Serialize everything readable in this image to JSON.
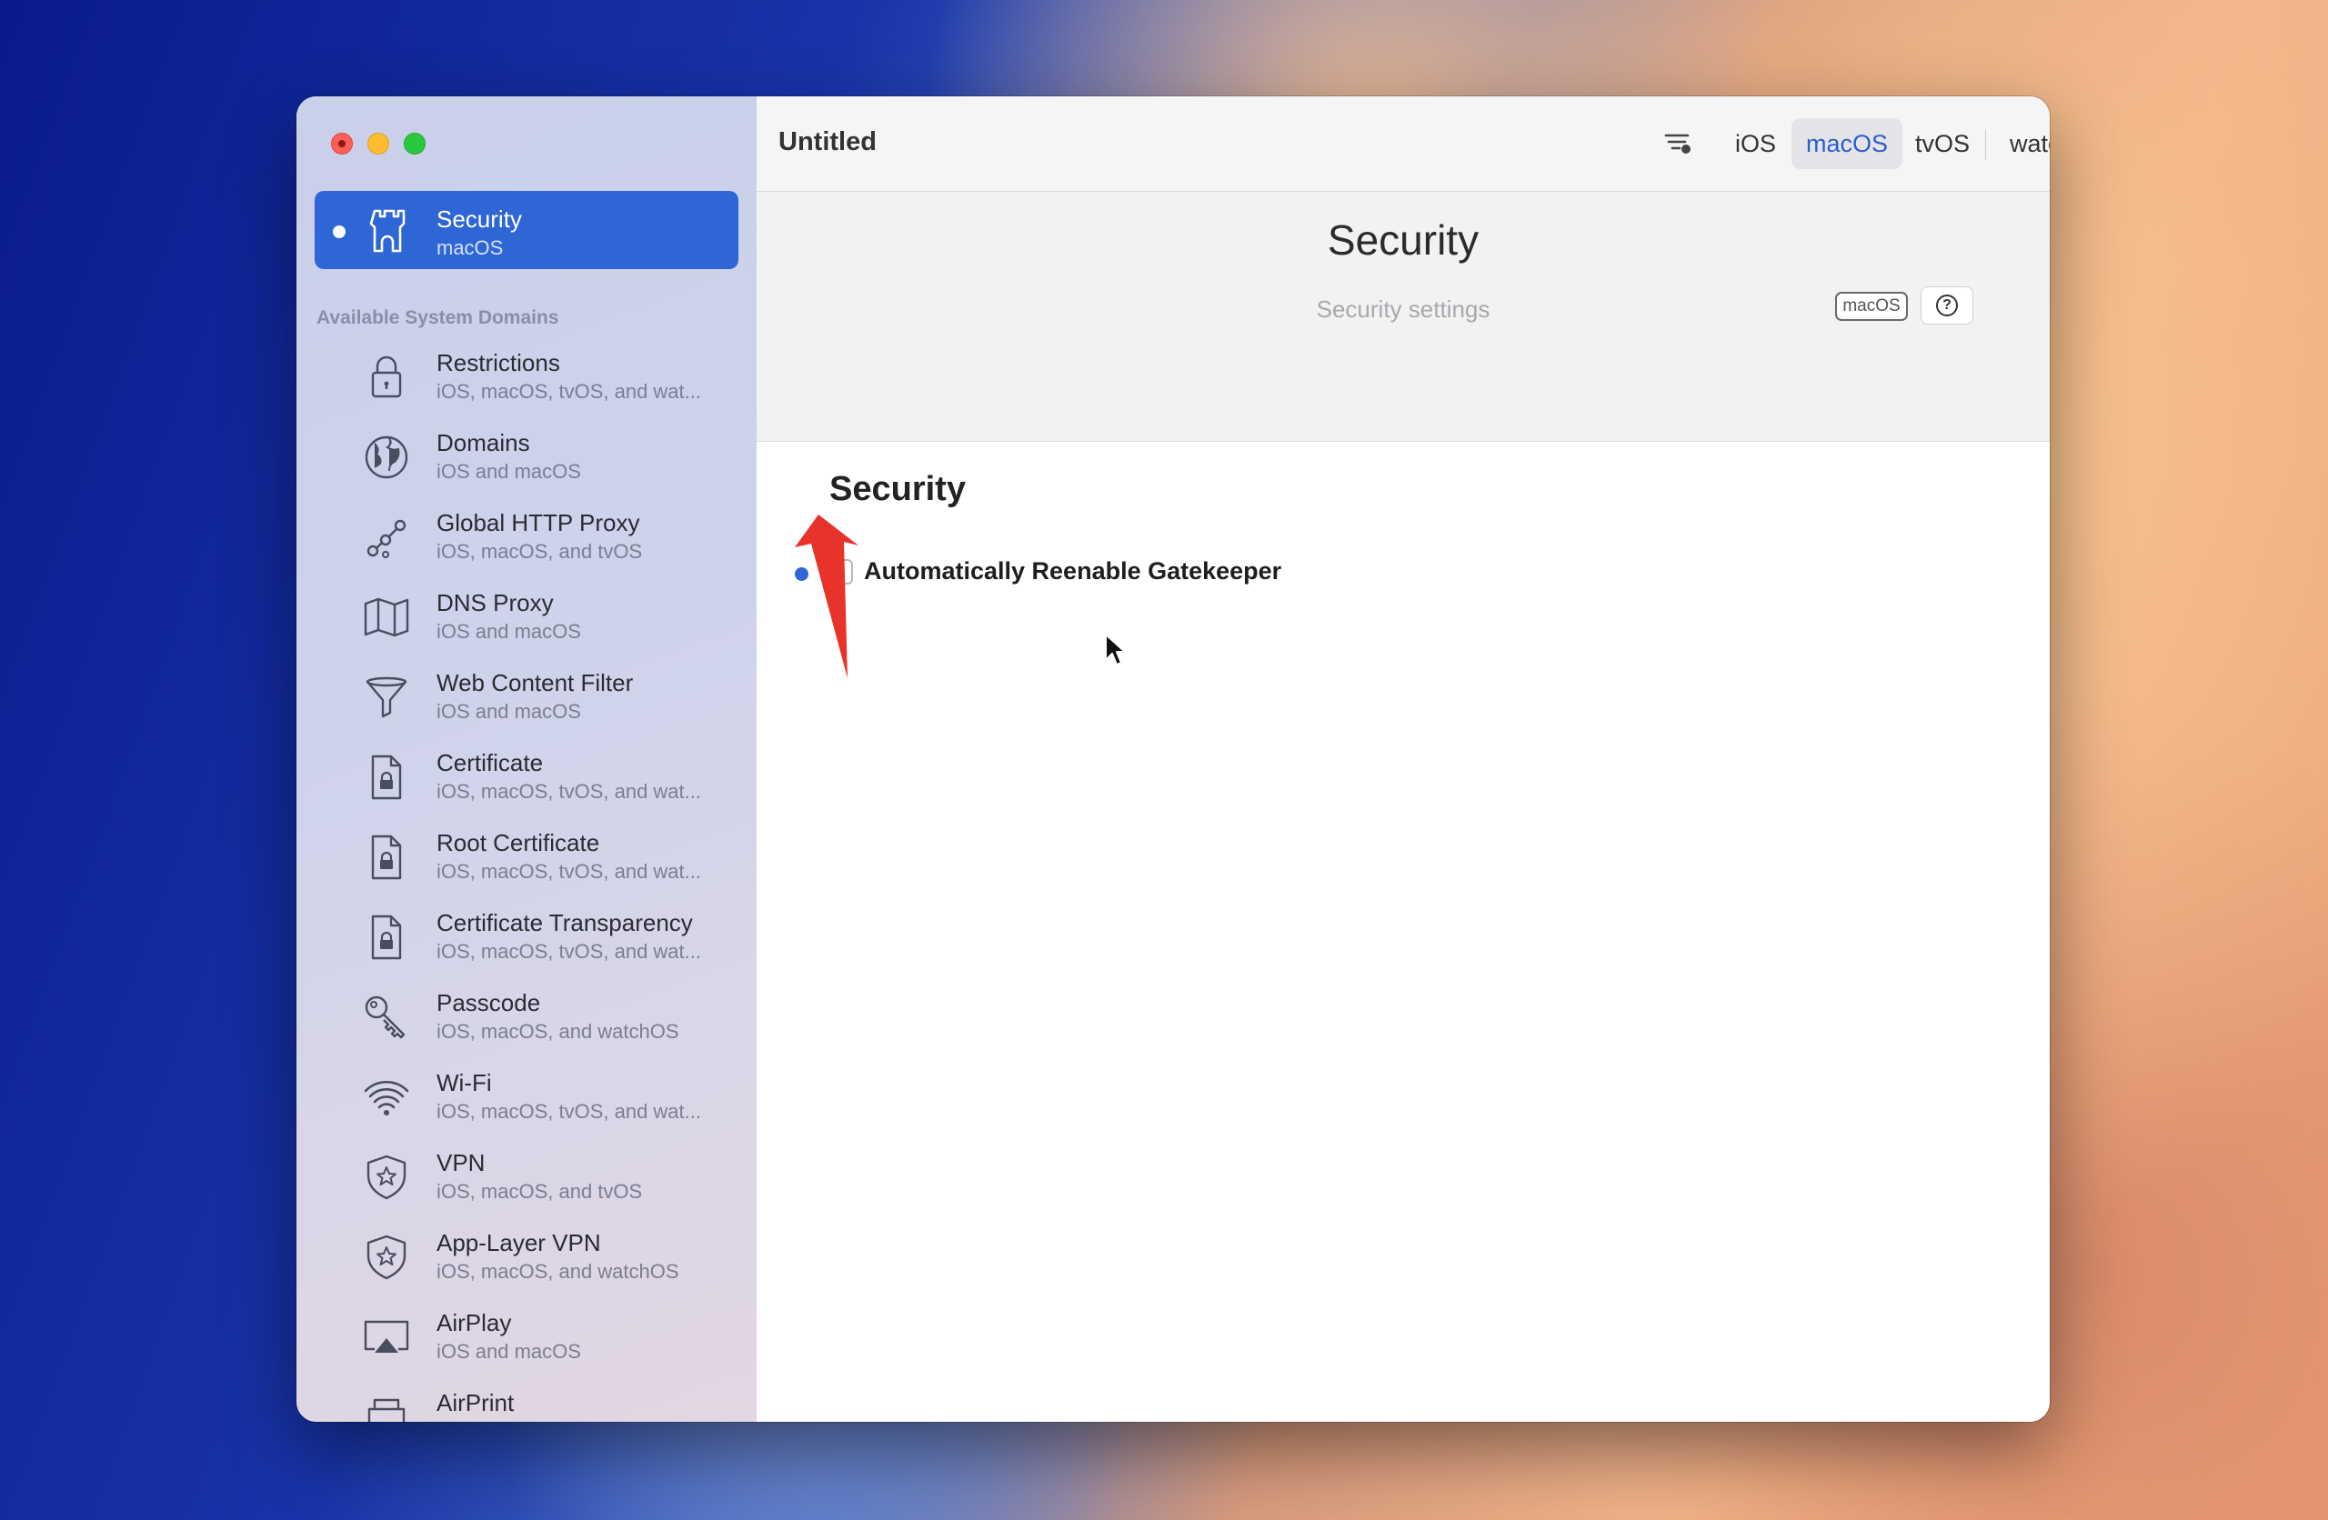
{
  "window": {
    "title": "Untitled"
  },
  "sidebar": {
    "selected": {
      "title": "Security",
      "subtitle": "macOS",
      "icon": "castle-tower-icon"
    },
    "section_header": "Available System Domains",
    "items": [
      {
        "title": "Restrictions",
        "subtitle": "iOS, macOS, tvOS, and wat...",
        "icon": "lock-icon"
      },
      {
        "title": "Domains",
        "subtitle": "iOS and macOS",
        "icon": "globe-icon"
      },
      {
        "title": "Global HTTP Proxy",
        "subtitle": "iOS, macOS, and tvOS",
        "icon": "network-nodes-icon"
      },
      {
        "title": "DNS Proxy",
        "subtitle": "iOS and macOS",
        "icon": "map-icon"
      },
      {
        "title": "Web Content Filter",
        "subtitle": "iOS and macOS",
        "icon": "funnel-icon"
      },
      {
        "title": "Certificate",
        "subtitle": "iOS, macOS, tvOS, and wat...",
        "icon": "lock-document-icon"
      },
      {
        "title": "Root Certificate",
        "subtitle": "iOS, macOS, tvOS, and wat...",
        "icon": "lock-document-icon"
      },
      {
        "title": "Certificate Transparency",
        "subtitle": "iOS, macOS, tvOS, and wat...",
        "icon": "lock-document-icon"
      },
      {
        "title": "Passcode",
        "subtitle": "iOS, macOS, and watchOS",
        "icon": "key-icon"
      },
      {
        "title": "Wi-Fi",
        "subtitle": "iOS, macOS, tvOS, and wat...",
        "icon": "wifi-icon"
      },
      {
        "title": "VPN",
        "subtitle": "iOS, macOS, and tvOS",
        "icon": "shield-star-icon"
      },
      {
        "title": "App-Layer VPN",
        "subtitle": "iOS, macOS, and watchOS",
        "icon": "shield-star-icon"
      },
      {
        "title": "AirPlay",
        "subtitle": "iOS and macOS",
        "icon": "airplay-icon"
      },
      {
        "title": "AirPrint",
        "subtitle": "",
        "icon": "printer-icon"
      }
    ]
  },
  "toolbar": {
    "filter_icon": "filter-icon",
    "platforms": [
      "iOS",
      "macOS",
      "tvOS",
      "watchOS"
    ],
    "active_platform": "macOS",
    "device_icon": "device-check-icon",
    "search_icon": "search-icon",
    "help_icon": "help-icon"
  },
  "header": {
    "title": "Security",
    "subtitle": "Security settings",
    "badge": "macOS",
    "help": "?"
  },
  "section": {
    "title": "Security",
    "settings": [
      {
        "label": "Automatically Reenable Gatekeeper",
        "checked": false
      }
    ]
  },
  "colors": {
    "accent": "#2f66d6",
    "annotation_arrow": "#e8332a"
  }
}
